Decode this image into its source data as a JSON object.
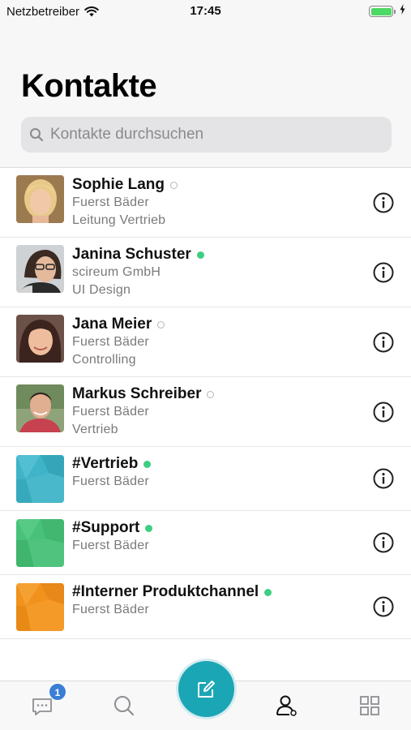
{
  "status_bar": {
    "carrier": "Netzbetreiber",
    "time": "17:45",
    "battery_level": 1.0
  },
  "header": {
    "title": "Kontakte"
  },
  "search": {
    "placeholder": "Kontakte durchsuchen"
  },
  "contacts": [
    {
      "name": "Sophie Lang",
      "status": "offline",
      "company": "Fuerst Bäder",
      "role": "Leitung Vertrieb"
    },
    {
      "name": "Janina Schuster",
      "status": "online",
      "company": "scireum GmbH",
      "role": "UI Design"
    },
    {
      "name": "Jana Meier",
      "status": "offline",
      "company": "Fuerst Bäder",
      "role": "Controlling"
    },
    {
      "name": "Markus Schreiber",
      "status": "offline",
      "company": "Fuerst Bäder",
      "role": "Vertrieb"
    }
  ],
  "channels": [
    {
      "name": "#Vertrieb",
      "status": "online",
      "company": "Fuerst Bäder",
      "color": "#3fb3c8"
    },
    {
      "name": "#Support",
      "status": "online",
      "company": "Fuerst Bäder",
      "color": "#48c27a"
    },
    {
      "name": "#Interner Produktchannel",
      "status": "online",
      "company": "Fuerst Bäder",
      "color": "#f0921c"
    }
  ],
  "tab_bar": {
    "chat_badge": "1",
    "active_tab": "contacts",
    "fab_icon": "compose-icon"
  },
  "colors": {
    "accent": "#1ba6b5",
    "online": "#3ccf82",
    "badge": "#3a7fd6"
  }
}
